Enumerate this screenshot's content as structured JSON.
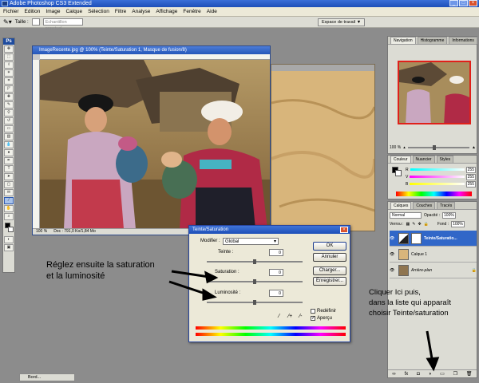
{
  "window": {
    "title": "Adobe Photoshop CS3 Extended"
  },
  "menu": [
    "Fichier",
    "Edition",
    "Image",
    "Calque",
    "Sélection",
    "Filtre",
    "Analyse",
    "Affichage",
    "Fenêtre",
    "Aide"
  ],
  "options": {
    "size_label": "Taille :",
    "brush_placeholder": "Echantillon ponctuel",
    "workspace": "Espace de travail ▼"
  },
  "toolbox": {
    "logo": "Ps"
  },
  "document": {
    "title": "ImageRecente.jpg @ 100% (Teinte/Saturation 1, Masque de fusion/8)",
    "zoom": "100 %",
    "doc_info": "Doc : 791,0 Ko/1,84 Mo"
  },
  "navigator": {
    "tabs": [
      "Navigation",
      "Histogramme",
      "Informations"
    ],
    "zoom": "100 %"
  },
  "color_panel": {
    "tabs": [
      "Couleur",
      "Nuancier",
      "Styles"
    ],
    "channels": [
      {
        "label": "R",
        "value": "255"
      },
      {
        "label": "V",
        "value": "255"
      },
      {
        "label": "B",
        "value": "255"
      }
    ]
  },
  "layers": {
    "tabs": [
      "Calques",
      "Couches",
      "Tracés"
    ],
    "mode": "Normal",
    "opacity_label": "Opacité :",
    "opacity": "100%",
    "lock_label": "Verrou :",
    "fill_label": "Fond :",
    "fill": "100%",
    "items": [
      {
        "name": "Teinte/Saturatio..."
      },
      {
        "name": "Calque 1"
      },
      {
        "name": "Arrière-plan"
      }
    ]
  },
  "dialog": {
    "title": "Teinte/Saturation",
    "modifier_label": "Modifier :",
    "modifier_value": "Global",
    "teinte_label": "Teinte :",
    "teinte_value": "0",
    "saturation_label": "Saturation :",
    "saturation_value": "0",
    "luminosite_label": "Luminosité :",
    "luminosite_value": "0",
    "ok": "OK",
    "cancel": "Annuler",
    "load": "Charger...",
    "save": "Enregistrer...",
    "colorize": "Redéfinir",
    "preview": "Aperçu"
  },
  "annotations": {
    "left_line1": "Réglez ensuite la saturation",
    "left_line2": "et la luminosité",
    "right_line1": "Cliquer Ici puis,",
    "right_line2": "dans la liste qui apparaît",
    "right_line3": "choisir Teinte/saturation"
  },
  "taskbar": {
    "item": "Bord..."
  }
}
